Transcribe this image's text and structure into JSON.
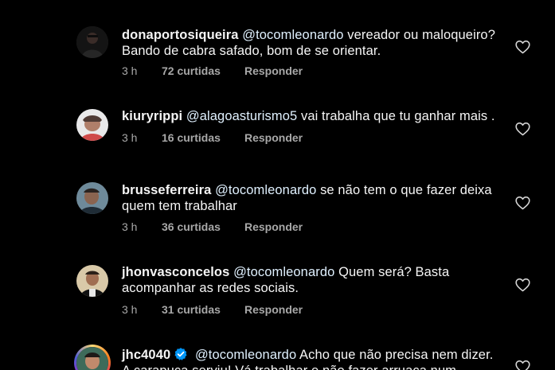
{
  "top_partial": "···",
  "comments": [
    {
      "username": "donaportosiqueira",
      "mention": "@tocomleonardo",
      "text": "vereador ou maloqueiro? Bando de cabra safado, bom de se orientar.",
      "time": "3 h",
      "likes": "72 curtidas",
      "reply": "Responder"
    },
    {
      "username": "kiuryrippi",
      "mention": "@alagoasturismo5",
      "text": "vai trabalha que tu ganhar mais .",
      "time": "3 h",
      "likes": "16 curtidas",
      "reply": "Responder"
    },
    {
      "username": "brusseferreira",
      "mention": "@tocomleonardo",
      "text": "se não tem o que fazer deixa quem tem trabalhar",
      "time": "3 h",
      "likes": "36 curtidas",
      "reply": "Responder"
    },
    {
      "username": "jhonvasconcelos",
      "mention": "@tocomleonardo",
      "text": "Quem será? Basta acompanhar as redes sociais.",
      "time": "3 h",
      "likes": "31 curtidas",
      "reply": "Responder"
    },
    {
      "username": "jhc4040",
      "mention": "@tocomleonardo",
      "text": "Acho que não precisa nem dizer. A carapuça serviu! Vá trabalhar e não fazer arruaça num"
    }
  ],
  "colors": {
    "background": "#000000",
    "primary_text": "#f5f5f5",
    "secondary_text": "#a8a8a8",
    "mention": "#e0f1ff",
    "verified": "#0095f6"
  },
  "icons": {
    "like": "heart-outline-icon",
    "verified": "verified-badge-icon"
  }
}
